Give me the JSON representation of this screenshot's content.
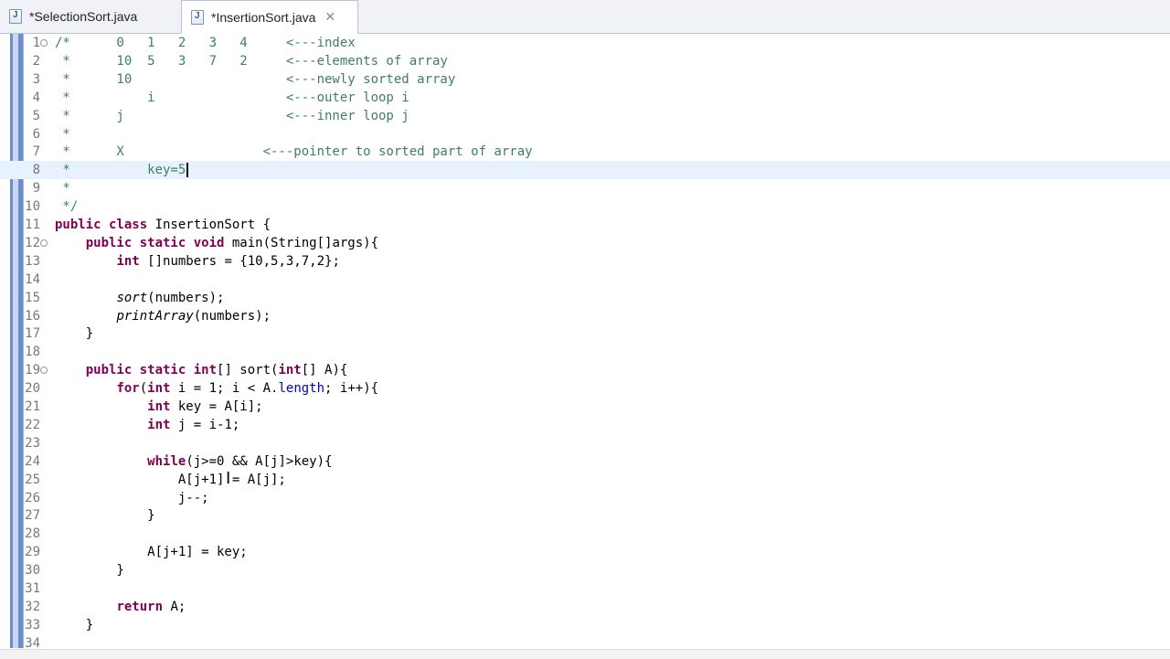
{
  "tabs": [
    {
      "label": "*SelectionSort.java",
      "icon": "java-file-icon",
      "active": false
    },
    {
      "label": "*InsertionSort.java",
      "icon": "java-file-icon",
      "active": true,
      "close": "✕"
    }
  ],
  "colors": {
    "comment": "#3f7f5f",
    "keyword": "#7f0055",
    "field": "#0000c0",
    "current_line": "#e8f2fe",
    "line_number": "#787878"
  },
  "editor": {
    "current_line": 8,
    "lines": [
      {
        "n": "1",
        "fold": "⊖",
        "tokens": [
          [
            "c",
            "/*      0   1   2   3   4     <---index"
          ]
        ]
      },
      {
        "n": "2",
        "tokens": [
          [
            "c",
            " *      10  5   3   7   2     <---elements of array"
          ]
        ]
      },
      {
        "n": "3",
        "tokens": [
          [
            "c",
            " *      10                    <---newly sorted array"
          ]
        ]
      },
      {
        "n": "4",
        "tokens": [
          [
            "c",
            " *          i                 <---outer loop i"
          ]
        ]
      },
      {
        "n": "5",
        "tokens": [
          [
            "c",
            " *      j                     <---inner loop j"
          ]
        ]
      },
      {
        "n": "6",
        "tokens": [
          [
            "c",
            " *"
          ]
        ]
      },
      {
        "n": "7",
        "tokens": [
          [
            "c",
            " *      X                  <---pointer to sorted part of array"
          ]
        ]
      },
      {
        "n": "8",
        "tokens": [
          [
            "c",
            " *          key=5"
          ]
        ],
        "caret": true
      },
      {
        "n": "9",
        "tokens": [
          [
            "c",
            " *"
          ]
        ]
      },
      {
        "n": "10",
        "tokens": [
          [
            "c",
            " */"
          ]
        ]
      },
      {
        "n": "11",
        "tokens": [
          [
            "k",
            "public class "
          ],
          [
            "p",
            "InsertionSort {"
          ]
        ]
      },
      {
        "n": "12",
        "fold": "⊖",
        "tokens": [
          [
            "p",
            "    "
          ],
          [
            "k",
            "public static void "
          ],
          [
            "p",
            "main(String[]args){"
          ]
        ]
      },
      {
        "n": "13",
        "tokens": [
          [
            "p",
            "        "
          ],
          [
            "k",
            "int "
          ],
          [
            "p",
            "[]numbers = {10,5,3,7,2};"
          ]
        ]
      },
      {
        "n": "14",
        "tokens": []
      },
      {
        "n": "15",
        "tokens": [
          [
            "p",
            "        "
          ],
          [
            "i",
            "sort"
          ],
          [
            "p",
            "(numbers);"
          ]
        ]
      },
      {
        "n": "16",
        "tokens": [
          [
            "p",
            "        "
          ],
          [
            "i",
            "printArray"
          ],
          [
            "p",
            "(numbers);"
          ]
        ]
      },
      {
        "n": "17",
        "tokens": [
          [
            "p",
            "    }"
          ]
        ]
      },
      {
        "n": "18",
        "tokens": []
      },
      {
        "n": "19",
        "fold": "⊖",
        "tokens": [
          [
            "p",
            "    "
          ],
          [
            "k",
            "public static int"
          ],
          [
            "p",
            "[] sort("
          ],
          [
            "k",
            "int"
          ],
          [
            "p",
            "[] A){"
          ]
        ]
      },
      {
        "n": "20",
        "tokens": [
          [
            "p",
            "        "
          ],
          [
            "k",
            "for"
          ],
          [
            "p",
            "("
          ],
          [
            "k",
            "int "
          ],
          [
            "p",
            "i = 1; i < A."
          ],
          [
            "f",
            "length"
          ],
          [
            "p",
            "; i++){"
          ]
        ]
      },
      {
        "n": "21",
        "tokens": [
          [
            "p",
            "            "
          ],
          [
            "k",
            "int "
          ],
          [
            "p",
            "key = A[i];"
          ]
        ]
      },
      {
        "n": "22",
        "tokens": [
          [
            "p",
            "            "
          ],
          [
            "k",
            "int "
          ],
          [
            "p",
            "j = i-1;"
          ]
        ]
      },
      {
        "n": "23",
        "tokens": []
      },
      {
        "n": "24",
        "tokens": [
          [
            "p",
            "            "
          ],
          [
            "k",
            "while"
          ],
          [
            "p",
            "(j>=0 && A[j]>key){"
          ]
        ]
      },
      {
        "n": "25",
        "tokens": [
          [
            "p",
            "                A[j+1] = A[j];"
          ]
        ]
      },
      {
        "n": "26",
        "tokens": [
          [
            "p",
            "                j--;"
          ]
        ]
      },
      {
        "n": "27",
        "tokens": [
          [
            "p",
            "            }"
          ]
        ]
      },
      {
        "n": "28",
        "tokens": []
      },
      {
        "n": "29",
        "tokens": [
          [
            "p",
            "            A[j+1] = key;"
          ]
        ]
      },
      {
        "n": "30",
        "tokens": [
          [
            "p",
            "        }"
          ]
        ]
      },
      {
        "n": "31",
        "tokens": []
      },
      {
        "n": "32",
        "tokens": [
          [
            "p",
            "        "
          ],
          [
            "k",
            "return "
          ],
          [
            "p",
            "A;"
          ]
        ]
      },
      {
        "n": "33",
        "tokens": [
          [
            "p",
            "    }"
          ]
        ]
      },
      {
        "n": "34",
        "tokens": []
      }
    ]
  }
}
